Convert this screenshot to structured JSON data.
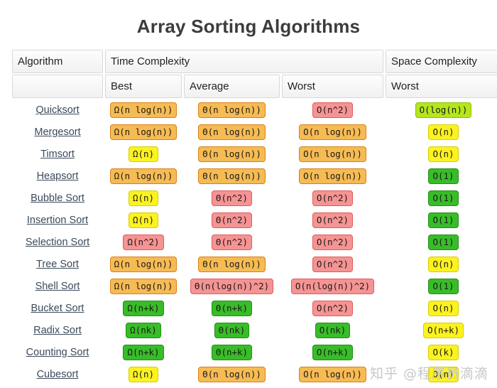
{
  "title": "Array Sorting Algorithms",
  "watermark": "知乎 @程序员滴滴",
  "table": {
    "group_headers": {
      "algorithm": "Algorithm",
      "time_complexity": "Time Complexity",
      "space_complexity": "Space Complexity"
    },
    "sub_headers": {
      "algorithm": "",
      "best": "Best",
      "average": "Average",
      "worst": "Worst",
      "space_worst": "Worst"
    },
    "rows": [
      {
        "algorithm": "Quicksort",
        "best": {
          "text": "Ω(n log(n))",
          "color": "orange"
        },
        "average": {
          "text": "Θ(n log(n))",
          "color": "orange"
        },
        "worst": {
          "text": "O(n^2)",
          "color": "red"
        },
        "space": {
          "text": "O(log(n))",
          "color": "lightgreen"
        }
      },
      {
        "algorithm": "Mergesort",
        "best": {
          "text": "Ω(n log(n))",
          "color": "orange"
        },
        "average": {
          "text": "Θ(n log(n))",
          "color": "orange"
        },
        "worst": {
          "text": "O(n log(n))",
          "color": "orange"
        },
        "space": {
          "text": "O(n)",
          "color": "yellow"
        }
      },
      {
        "algorithm": "Timsort",
        "best": {
          "text": "Ω(n)",
          "color": "yellow"
        },
        "average": {
          "text": "Θ(n log(n))",
          "color": "orange"
        },
        "worst": {
          "text": "O(n log(n))",
          "color": "orange"
        },
        "space": {
          "text": "O(n)",
          "color": "yellow"
        }
      },
      {
        "algorithm": "Heapsort",
        "best": {
          "text": "Ω(n log(n))",
          "color": "orange"
        },
        "average": {
          "text": "Θ(n log(n))",
          "color": "orange"
        },
        "worst": {
          "text": "O(n log(n))",
          "color": "orange"
        },
        "space": {
          "text": "O(1)",
          "color": "green"
        }
      },
      {
        "algorithm": "Bubble Sort",
        "best": {
          "text": "Ω(n)",
          "color": "yellow"
        },
        "average": {
          "text": "Θ(n^2)",
          "color": "red"
        },
        "worst": {
          "text": "O(n^2)",
          "color": "red"
        },
        "space": {
          "text": "O(1)",
          "color": "green"
        }
      },
      {
        "algorithm": "Insertion Sort",
        "best": {
          "text": "Ω(n)",
          "color": "yellow"
        },
        "average": {
          "text": "Θ(n^2)",
          "color": "red"
        },
        "worst": {
          "text": "O(n^2)",
          "color": "red"
        },
        "space": {
          "text": "O(1)",
          "color": "green"
        }
      },
      {
        "algorithm": "Selection Sort",
        "best": {
          "text": "Ω(n^2)",
          "color": "red"
        },
        "average": {
          "text": "Θ(n^2)",
          "color": "red"
        },
        "worst": {
          "text": "O(n^2)",
          "color": "red"
        },
        "space": {
          "text": "O(1)",
          "color": "green"
        }
      },
      {
        "algorithm": "Tree Sort",
        "best": {
          "text": "Ω(n log(n))",
          "color": "orange"
        },
        "average": {
          "text": "Θ(n log(n))",
          "color": "orange"
        },
        "worst": {
          "text": "O(n^2)",
          "color": "red"
        },
        "space": {
          "text": "O(n)",
          "color": "yellow"
        }
      },
      {
        "algorithm": "Shell Sort",
        "best": {
          "text": "Ω(n log(n))",
          "color": "orange"
        },
        "average": {
          "text": "Θ(n(log(n))^2)",
          "color": "red"
        },
        "worst": {
          "text": "O(n(log(n))^2)",
          "color": "red"
        },
        "space": {
          "text": "O(1)",
          "color": "green"
        }
      },
      {
        "algorithm": "Bucket Sort",
        "best": {
          "text": "Ω(n+k)",
          "color": "green"
        },
        "average": {
          "text": "Θ(n+k)",
          "color": "green"
        },
        "worst": {
          "text": "O(n^2)",
          "color": "red"
        },
        "space": {
          "text": "O(n)",
          "color": "yellow"
        }
      },
      {
        "algorithm": "Radix Sort",
        "best": {
          "text": "Ω(nk)",
          "color": "green"
        },
        "average": {
          "text": "Θ(nk)",
          "color": "green"
        },
        "worst": {
          "text": "O(nk)",
          "color": "green"
        },
        "space": {
          "text": "O(n+k)",
          "color": "yellow"
        }
      },
      {
        "algorithm": "Counting Sort",
        "best": {
          "text": "Ω(n+k)",
          "color": "green"
        },
        "average": {
          "text": "Θ(n+k)",
          "color": "green"
        },
        "worst": {
          "text": "O(n+k)",
          "color": "green"
        },
        "space": {
          "text": "O(k)",
          "color": "yellow"
        }
      },
      {
        "algorithm": "Cubesort",
        "best": {
          "text": "Ω(n)",
          "color": "yellow"
        },
        "average": {
          "text": "Θ(n log(n))",
          "color": "orange"
        },
        "worst": {
          "text": "O(n log(n))",
          "color": "orange"
        },
        "space": {
          "text": "O(n)",
          "color": "yellow"
        }
      }
    ]
  }
}
